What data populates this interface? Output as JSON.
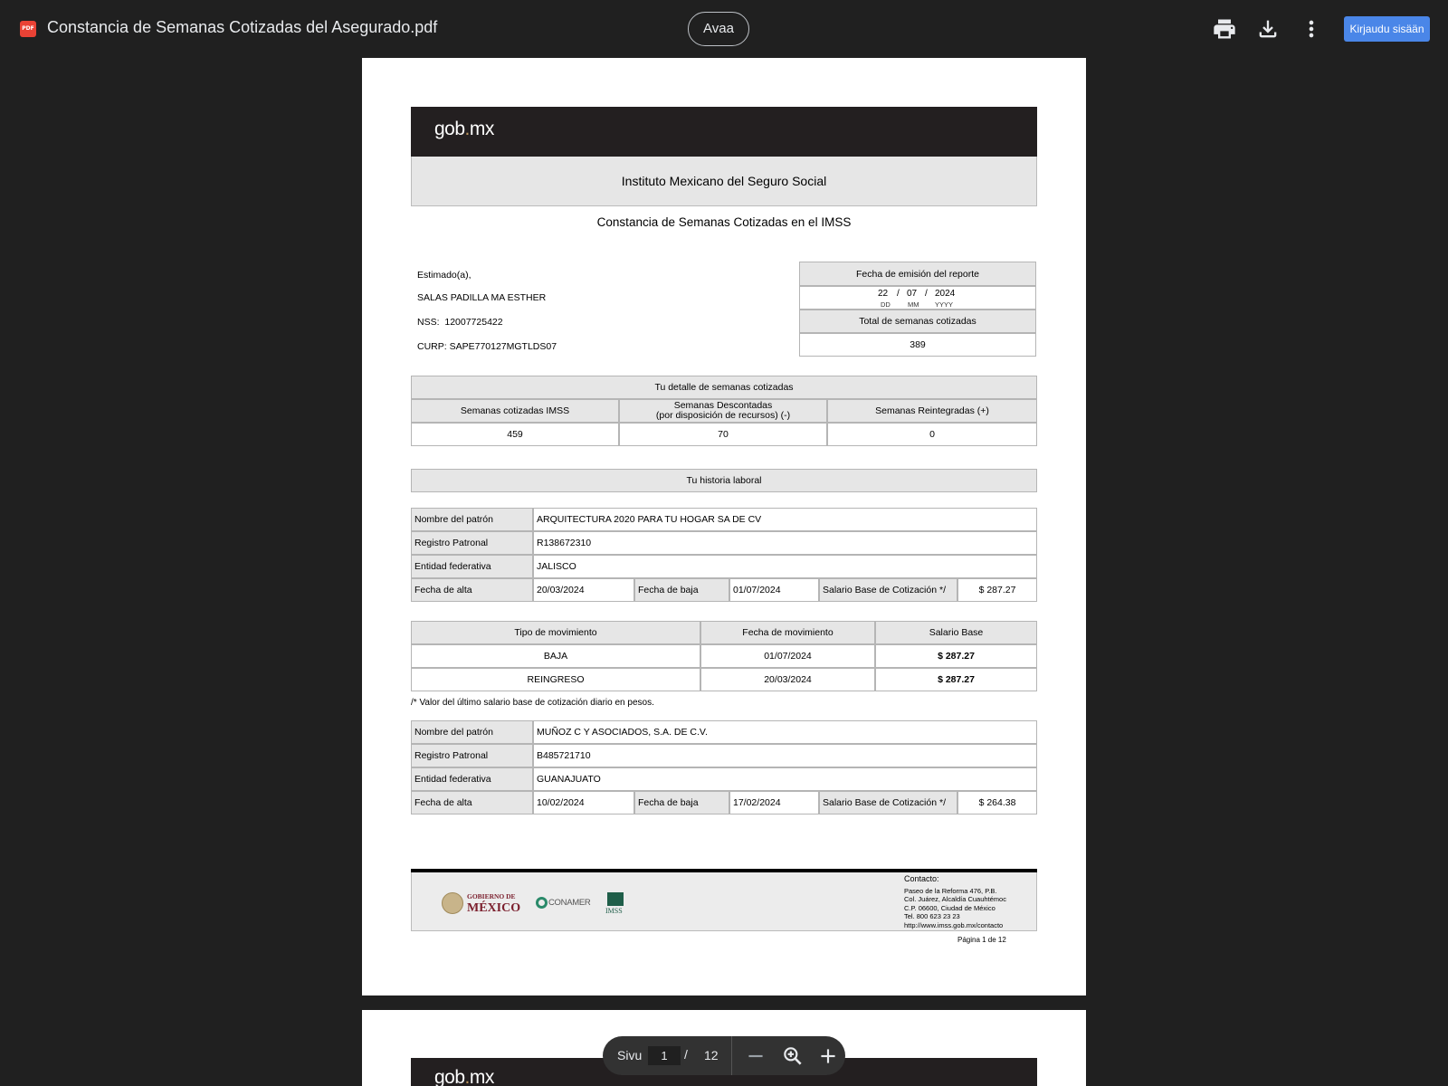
{
  "viewer": {
    "file_name": "Constancia de Semanas Cotizadas del Asegurado.pdf",
    "open_label": "Avaa",
    "signin_label": "Kirjaudu sisään",
    "pdf_badge": "PDF",
    "page_label": "Sivu",
    "page_current": "1",
    "page_sep": "/",
    "page_total": "12",
    "icons": [
      "print-icon",
      "download-icon",
      "more-icon",
      "zoom-out-icon",
      "zoom-fit-icon",
      "zoom-in-icon"
    ]
  },
  "doc": {
    "logo_text_a": "gob",
    "logo_text_dot": ".",
    "logo_text_b": "mx",
    "institution": "Instituto Mexicano del Seguro Social",
    "title": "Constancia de Semanas Cotizadas en el IMSS",
    "greeting": "Estimado(a),",
    "name": "SALAS PADILLA MA ESTHER",
    "nss_label": "NSS:",
    "nss": "12007725422",
    "curp_label": "CURP:",
    "curp": "SAPE770127MGTLDS07",
    "emission_label": "Fecha de emisión del reporte",
    "emission_dd": "22",
    "emission_mm": "07",
    "emission_yyyy": "2024",
    "date_sep": "/",
    "dd_label": "DD",
    "mm_label": "MM",
    "yyyy_label": "YYYY",
    "total_label": "Total de semanas cotizadas",
    "total_value": "389",
    "detail": {
      "title": "Tu detalle de semanas cotizadas",
      "col1": "Semanas cotizadas IMSS",
      "col2_l1": "Semanas Descontadas",
      "col2_l2": "(por disposición de recursos)   (-)",
      "col3": "Semanas Reintegradas   (+)",
      "val1": "459",
      "val2": "70",
      "val3": "0"
    },
    "history_title": "Tu historia laboral",
    "labels": {
      "patron": "Nombre del patrón",
      "registro": "Registro Patronal",
      "entidad": "Entidad federativa",
      "alta": "Fecha de alta",
      "baja": "Fecha de baja",
      "salario": "Salario Base de Cotización */"
    },
    "employers": [
      {
        "patron": "ARQUITECTURA 2020 PARA TU HOGAR SA DE CV",
        "registro": "R138672310",
        "entidad": "JALISCO",
        "alta": "20/03/2024",
        "baja": "01/07/2024",
        "salario": "$ 287.27"
      },
      {
        "patron": "MUÑOZ C Y ASOCIADOS, S.A. DE C.V.",
        "registro": "B485721710",
        "entidad": "GUANAJUATO",
        "alta": "10/02/2024",
        "baja": "17/02/2024",
        "salario": "$ 264.38"
      }
    ],
    "movements": {
      "headers": [
        "Tipo de movimiento",
        "Fecha de movimiento",
        "Salario Base"
      ],
      "rows": [
        [
          "BAJA",
          "01/07/2024",
          "$ 287.27"
        ],
        [
          "REINGRESO",
          "20/03/2024",
          "$ 287.27"
        ]
      ]
    },
    "note": "/* Valor del último salario base de cotización diario en pesos.",
    "footer": {
      "gob_line1": "GOBIERNO DE",
      "gob_line2": "MÉXICO",
      "conamer": "CONAMER",
      "imss": "IMSS",
      "contact_title": "Contacto:",
      "contact_lines": [
        "Paseo de la Reforma 476, P.B.",
        "Col. Juárez, Alcaldía Cuauhtémoc",
        "C.P. 06600, Ciudad de México",
        "Tel. 800 623 23 23",
        "http://www.imss.gob.mx/contacto"
      ],
      "page_text": "Página 1 de 12"
    }
  }
}
